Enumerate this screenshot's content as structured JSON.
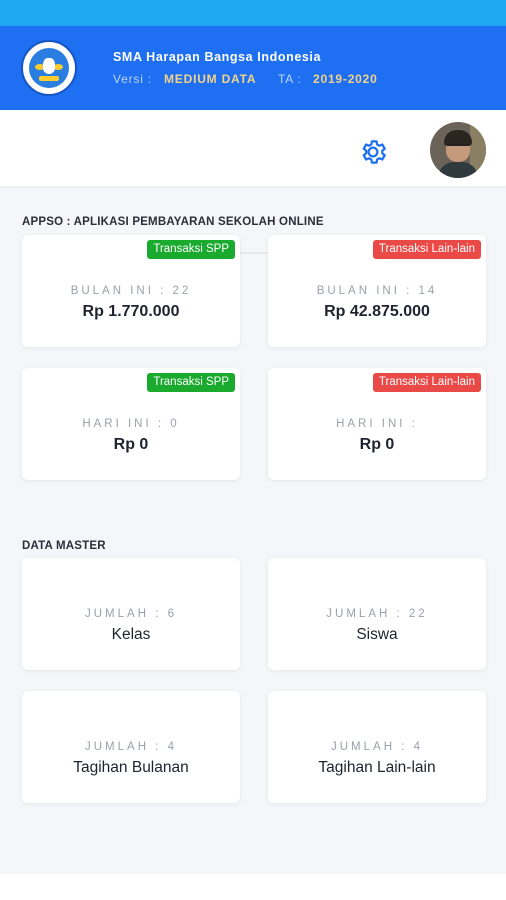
{
  "header": {
    "school_name": "SMA Harapan Bangsa Indonesia",
    "version_label": "Versi :",
    "version_value": "MEDIUM DATA",
    "year_label": "TA :",
    "year_value": "2019-2020"
  },
  "icons": {
    "logo": "school-logo",
    "settings": "gear-icon",
    "avatar": "user-avatar"
  },
  "colors": {
    "primary": "#1e6ff2",
    "status_bar": "#1fa7f2",
    "badge_green": "#1aaa2e",
    "badge_red": "#e94a48"
  },
  "payments": {
    "title": "APPSO : APLIKASI PEMBAYARAN SEKOLAH ONLINE",
    "cards": [
      {
        "badge": "Transaksi SPP",
        "label": "BULAN INI : 22",
        "value": "Rp 1.770.000"
      },
      {
        "badge": "Transaksi Lain-lain",
        "label": "BULAN INI : 14",
        "value": "Rp 42.875.000"
      },
      {
        "badge": "Transaksi SPP",
        "label": "HARI INI : 0",
        "value": "Rp 0"
      },
      {
        "badge": "Transaksi Lain-lain",
        "label": "HARI INI :",
        "value": "Rp 0"
      }
    ]
  },
  "master": {
    "title": "DATA MASTER",
    "cards": [
      {
        "label": "JUMLAH : 6",
        "value": "Kelas"
      },
      {
        "label": "JUMLAH : 22",
        "value": "Siswa"
      },
      {
        "label": "JUMLAH : 4",
        "value": "Tagihan Bulanan"
      },
      {
        "label": "JUMLAH : 4",
        "value": "Tagihan Lain-lain"
      }
    ]
  }
}
